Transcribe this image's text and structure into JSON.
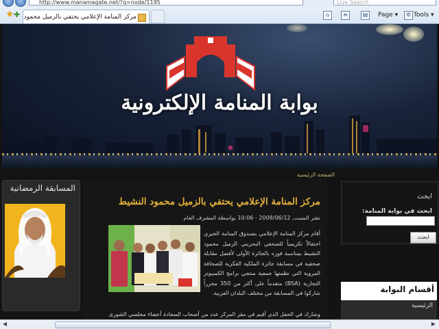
{
  "browser": {
    "url": "http://www.manamagate.net/?q=node/1195",
    "search_placeholder": "Live Search",
    "tab_title": "مركز المنامة الإعلامي يحتفي بالزميل محمود النشيط",
    "page_menu": "Page",
    "tools_menu": "Tools"
  },
  "site": {
    "banner_title": "بوابة المنامة الإلكترونية",
    "breadcrumb": "الصفحة الرئيسية"
  },
  "left_block": {
    "title": "المسابقة الرمضانية"
  },
  "article": {
    "title": "مركز المنامة الإعلامي يحتفي بالزميل محمود النشيط",
    "meta": "نشر السبت, 2008/06/12 - 10:06 بواسطة المشرف العام",
    "body": "أقام مركز المنامة الإعلامي بصندوق المنامة الخيري احتفالاً تكريمياً للصحفي البحريني الزميل محمود النشيط بمناسبة فوزه بالجائزة الأولى لأفضل مقابلة صحفية في مسابقة جائزة الملكية الفكرية للصحافة المروية التي نظمتها جمعية منتجي برامج الكمبيوتر التجارية (BSA) متقدماً على أكثر من 350 محرراً شاركوا في المسابقة من مختلف البلدان العربية.",
    "body2": "وشارك في الحفل الذي أقيم في مقر المركز عدد من أصحاب السعادة أعضاء مجلسي الشورى والنواب"
  },
  "search_block": {
    "title": "ابحث",
    "label": "ابحث في بوابة المنامة:",
    "button": "ابحث"
  },
  "sections_block": {
    "title": "أقسام البوابة",
    "first_item": "الرئيسية"
  },
  "colors": {
    "accent_gold": "#e3b13a",
    "logo_red": "#d9352c"
  }
}
